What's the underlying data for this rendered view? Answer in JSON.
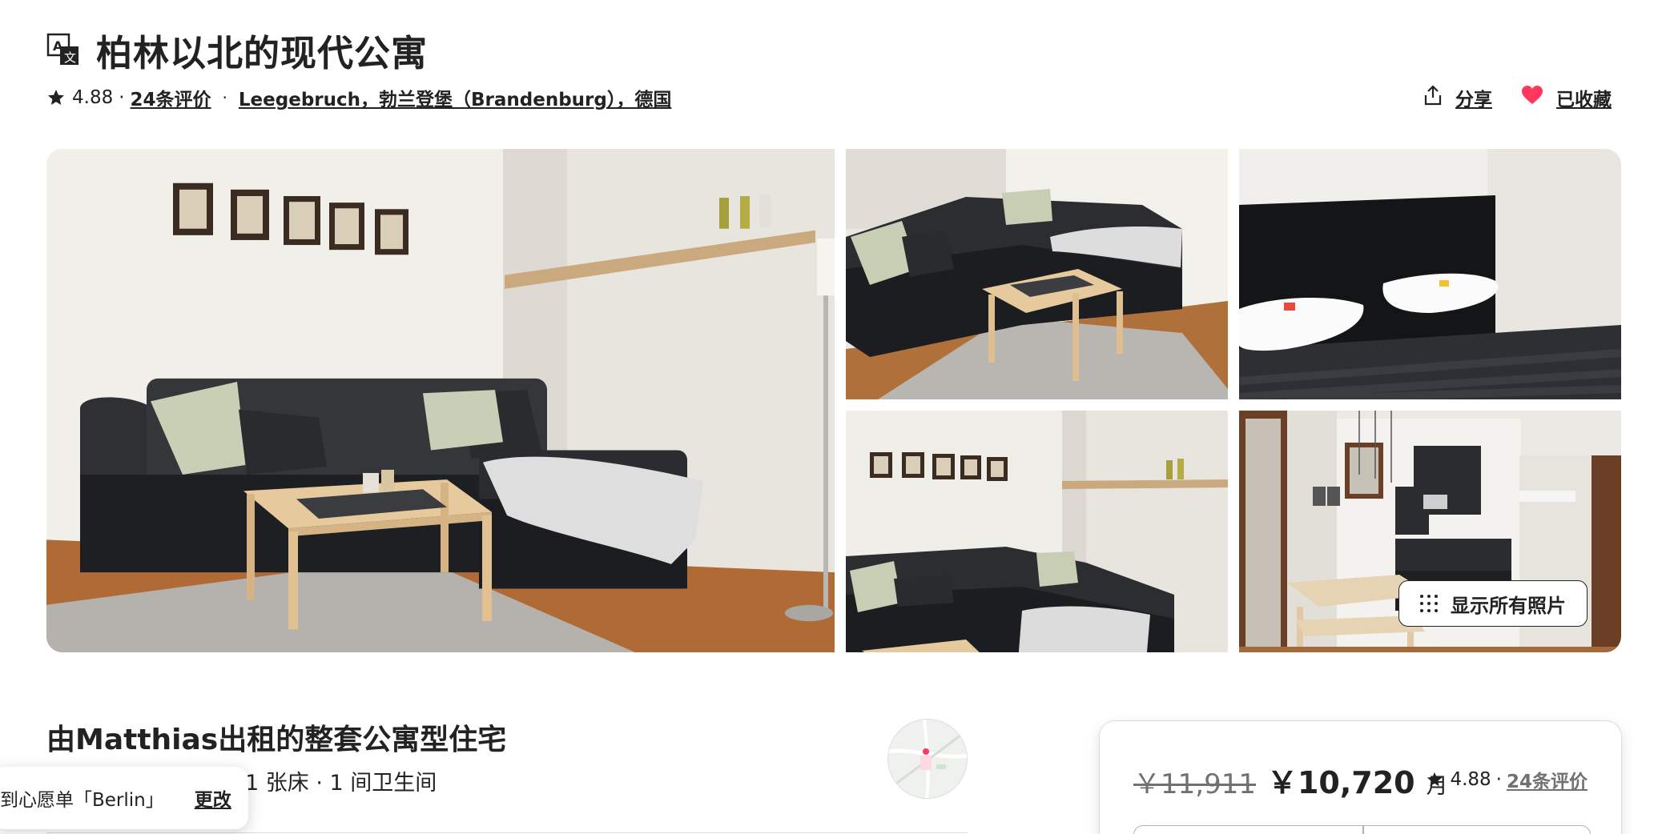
{
  "header": {
    "title": "柏林以北的现代公寓",
    "rating": "4.88",
    "reviews_link": "24条评价",
    "location_link": "Leegebruch，勃兰登堡（Brandenburg），德国",
    "share_label": "分享",
    "saved_label": "已收藏"
  },
  "gallery": {
    "show_all_label": "显示所有照片"
  },
  "listing": {
    "title": "由Matthias出租的整套公寓型住宅",
    "subtitle": "1 张床 · 1 间卫生间"
  },
  "toast": {
    "text": "到心愿单「Berlin」",
    "change_label": "更改"
  },
  "booking": {
    "old_price": "￥11,911",
    "new_price": "￥10,720",
    "per": "月",
    "rating": "4.88",
    "reviews_link": "24条评价"
  },
  "colors": {
    "text": "#222222",
    "muted": "#717171",
    "heart": "#ff385c",
    "border": "#dddddd"
  },
  "icons": [
    "translate-icon",
    "star-icon",
    "share-icon",
    "heart-icon",
    "grid-dots-icon"
  ]
}
